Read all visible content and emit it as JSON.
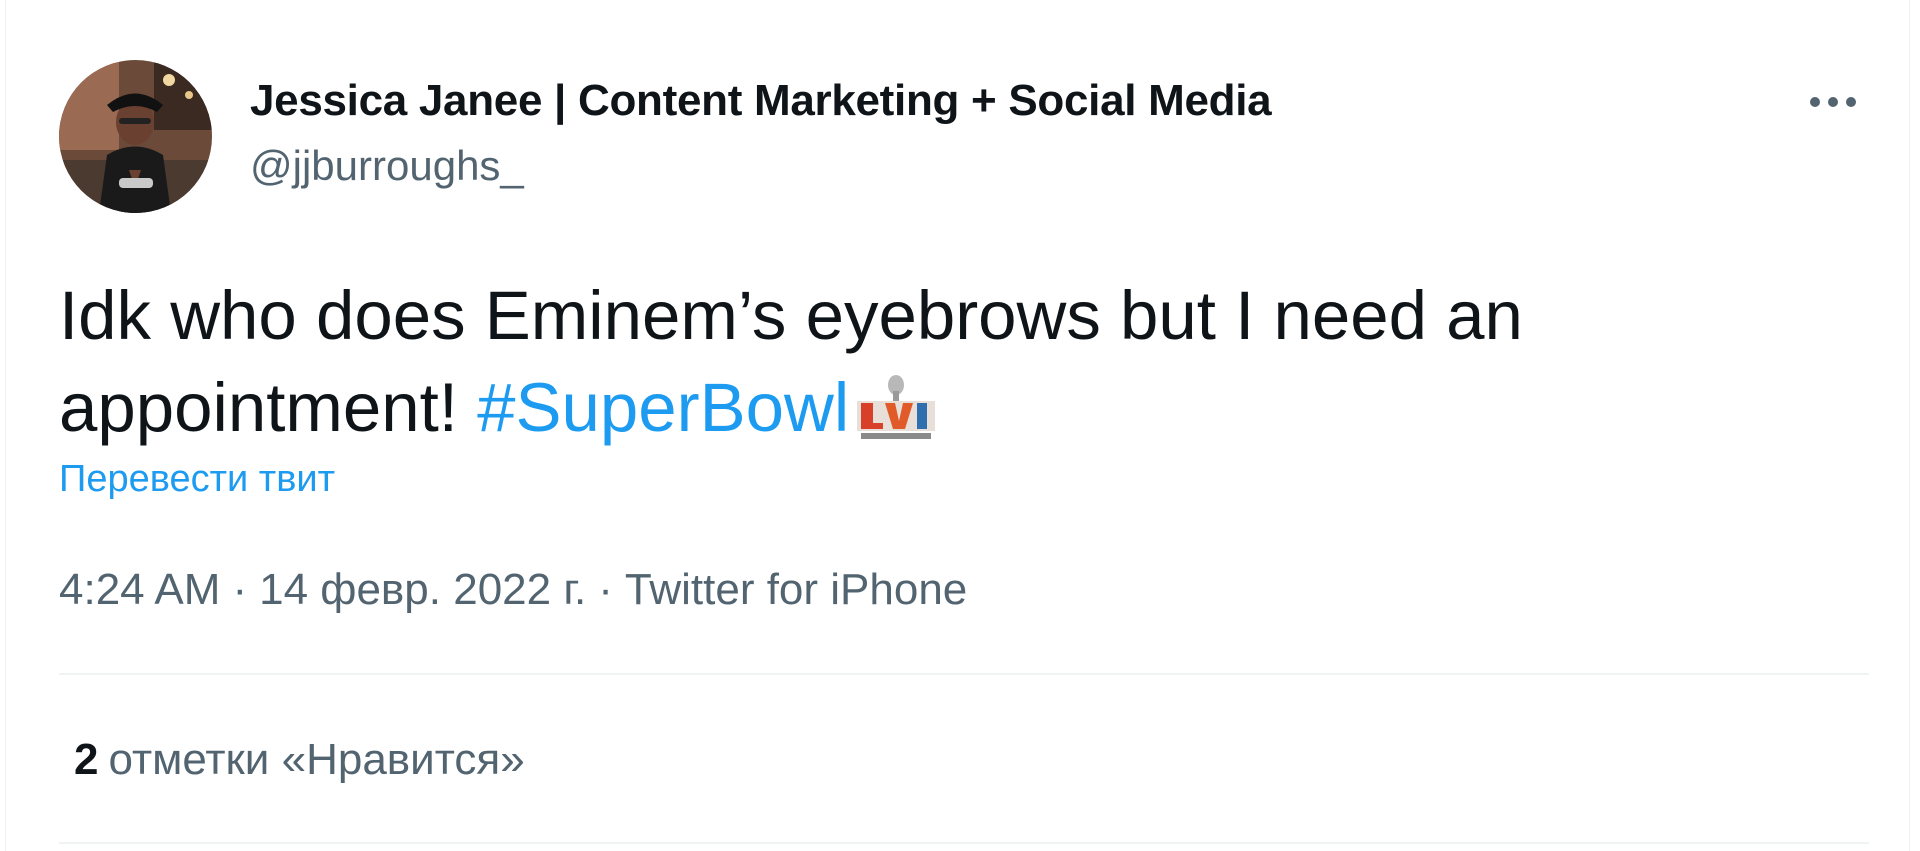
{
  "author": {
    "display_name": "Jessica Janee | Content Marketing + Social Media",
    "handle": "@jjburroughs_"
  },
  "tweet": {
    "text_line1": "Idk who does Eminem’s eyebrows but I need an",
    "text_line2_prefix": "appointment! ",
    "hashtag": "#SuperBowl",
    "hashtag_emoji": "super-bowl-lvi-logo"
  },
  "actions": {
    "translate_label": "Перевести твит",
    "more_icon": "more-horizontal-icon"
  },
  "meta": {
    "time": "4:24 AM",
    "separator": "·",
    "date": "14 февр. 2022 г.",
    "source": "Twitter for iPhone"
  },
  "stats": {
    "likes_count": "2",
    "likes_label": "отметки «Нравится»"
  },
  "colors": {
    "link": "#1d9bf0",
    "text_primary": "#0f1419",
    "text_secondary": "#536471",
    "divider": "#eff3f4"
  }
}
